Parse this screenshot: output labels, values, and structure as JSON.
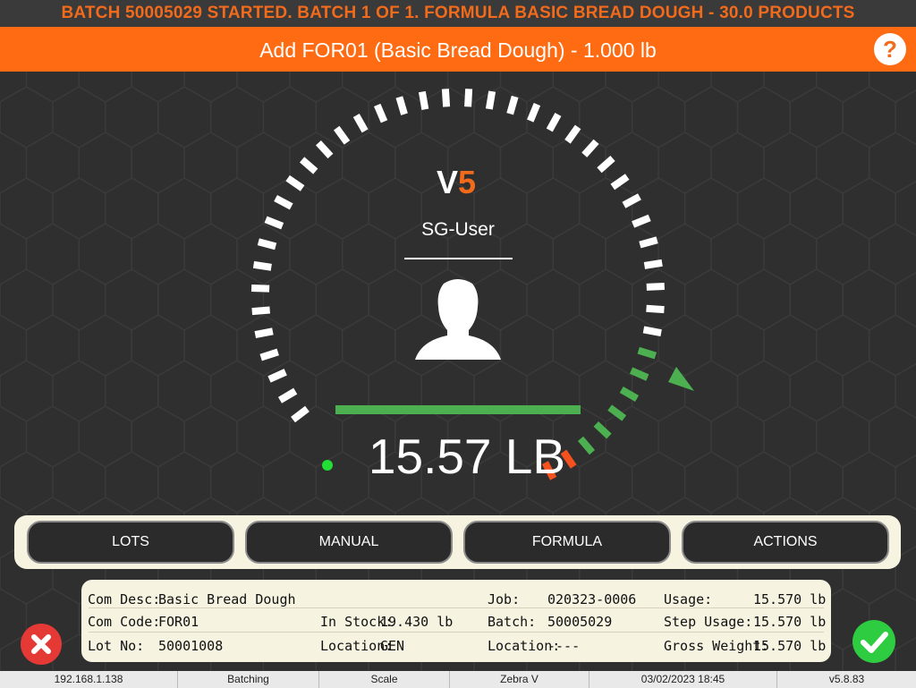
{
  "banner": "BATCH 50005029 STARTED. BATCH 1 OF 1. FORMULA BASIC BREAD DOUGH - 30.0 PRODUCTS",
  "step_title": "Add FOR01 (Basic Bread Dough) - 1.000 lb",
  "help_label": "?",
  "logo": {
    "v": "V",
    "five": "5"
  },
  "user_name": "SG-User",
  "weight_display": "15.57 LB",
  "colors": {
    "accent": "#ff6b12",
    "ok": "#4caf50",
    "over": "#f4511e",
    "panel": "#f6f3e1"
  },
  "buttons": [
    {
      "label": "LOTS"
    },
    {
      "label": "MANUAL"
    },
    {
      "label": "FORMULA"
    },
    {
      "label": "ACTIONS"
    }
  ],
  "info": {
    "com_desc_label": "Com Desc:",
    "com_desc": "Basic Bread Dough",
    "com_code_label": "Com Code:",
    "com_code": "FOR01",
    "lot_no_label": "Lot No:",
    "lot_no": "50001008",
    "in_stock_label": "In Stock:",
    "in_stock": "19.430 lb",
    "location_label": "Location:",
    "location": "GEN",
    "job_label": "Job:",
    "job": "020323-0006",
    "batch_label": "Batch:",
    "batch": "50005029",
    "location2_label": "Location:",
    "location2": "----",
    "usage_label": "Usage:",
    "usage": "15.570 lb",
    "step_usage_label": "Step Usage:",
    "step_usage": "15.570 lb",
    "gross_weight_label": "Gross Weight:",
    "gross_weight": "15.570 lb"
  },
  "status": {
    "ip": "192.168.1.138",
    "mode": "Batching",
    "device": "Scale",
    "printer": "Zebra V",
    "datetime": "03/02/2023 18:45",
    "version": "v5.8.83"
  }
}
